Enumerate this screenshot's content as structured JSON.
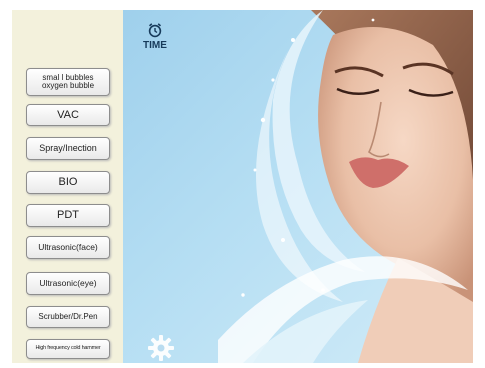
{
  "sidebar": {
    "buttons": [
      {
        "line1": "smal l bubbles",
        "line2": "oxygen bubble"
      },
      {
        "label": "VAC"
      },
      {
        "label": "Spray/Inection"
      },
      {
        "label": "BIO"
      },
      {
        "label": "PDT"
      },
      {
        "label": "Ultrasonic(face)"
      },
      {
        "label": "Ultrasonic(eye)"
      },
      {
        "label": "Scrubber/Dr.Pen"
      },
      {
        "label": "High frequency cold hammer"
      }
    ]
  },
  "timer": {
    "label": "TIME",
    "icon": "alarm-clock-icon"
  },
  "settings": {
    "icon": "gear-icon"
  },
  "colors": {
    "sidebar_bg": "#f3f1dc",
    "sky": "#a9d7ef",
    "water": "#eef8fd"
  }
}
